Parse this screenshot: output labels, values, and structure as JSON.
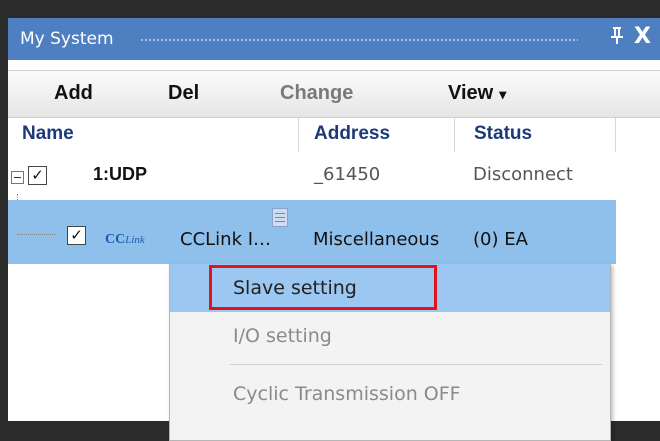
{
  "window": {
    "title": "My System",
    "pin_glyph": "P̸",
    "close_glyph": "X"
  },
  "toolbar": {
    "add_label": "Add",
    "del_label": "Del",
    "change_label": "Change",
    "view_label": "View",
    "view_caret": "▾"
  },
  "columns": {
    "name": "Name",
    "address": "Address",
    "status": "Status"
  },
  "tree": {
    "row1": {
      "name": "1:UDP",
      "address": "_61450",
      "status": "Disconnect",
      "checked": "✓"
    },
    "row2": {
      "logo_cc": "CC",
      "logo_link": "Link",
      "name": "CCLink I…",
      "address": "Miscellaneous",
      "status": "(0) EA",
      "checked": "✓"
    }
  },
  "context_menu": {
    "items": [
      {
        "label": "Slave setting"
      },
      {
        "label": "I/O setting"
      },
      {
        "label": "Cyclic Transmission OFF"
      }
    ]
  },
  "colors": {
    "titlebar": "#4d7fc1",
    "selection": "#8fc0ec",
    "menu_hover": "#9bc7f0",
    "highlight_box": "#e0141c",
    "header_text": "#1d3a78"
  }
}
